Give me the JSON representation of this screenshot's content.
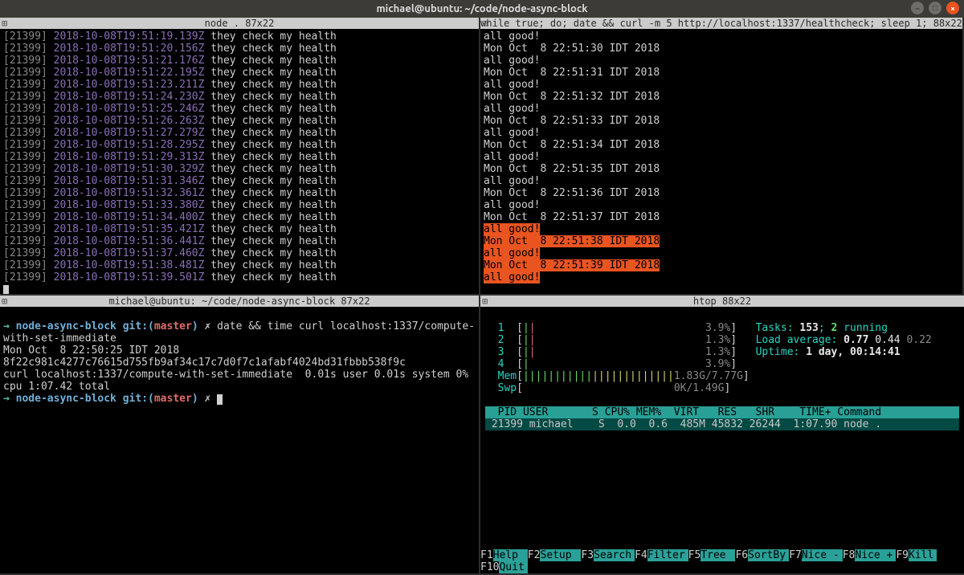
{
  "window": {
    "title": "michael@ubuntu: ~/code/node-async-block"
  },
  "panes": {
    "tl": {
      "title": "node . 87x22",
      "pid": "21399",
      "lines": [
        {
          "ts": "2018-10-08T19:51:19.139Z",
          "msg": "they check my health"
        },
        {
          "ts": "2018-10-08T19:51:20.156Z",
          "msg": "they check my health"
        },
        {
          "ts": "2018-10-08T19:51:21.176Z",
          "msg": "they check my health"
        },
        {
          "ts": "2018-10-08T19:51:22.195Z",
          "msg": "they check my health"
        },
        {
          "ts": "2018-10-08T19:51:23.211Z",
          "msg": "they check my health"
        },
        {
          "ts": "2018-10-08T19:51:24.230Z",
          "msg": "they check my health"
        },
        {
          "ts": "2018-10-08T19:51:25.246Z",
          "msg": "they check my health"
        },
        {
          "ts": "2018-10-08T19:51:26.263Z",
          "msg": "they check my health"
        },
        {
          "ts": "2018-10-08T19:51:27.279Z",
          "msg": "they check my health"
        },
        {
          "ts": "2018-10-08T19:51:28.295Z",
          "msg": "they check my health"
        },
        {
          "ts": "2018-10-08T19:51:29.313Z",
          "msg": "they check my health"
        },
        {
          "ts": "2018-10-08T19:51:30.329Z",
          "msg": "they check my health"
        },
        {
          "ts": "2018-10-08T19:51:31.346Z",
          "msg": "they check my health"
        },
        {
          "ts": "2018-10-08T19:51:32.361Z",
          "msg": "they check my health"
        },
        {
          "ts": "2018-10-08T19:51:33.380Z",
          "msg": "they check my health"
        },
        {
          "ts": "2018-10-08T19:51:34.400Z",
          "msg": "they check my health"
        },
        {
          "ts": "2018-10-08T19:51:35.421Z",
          "msg": "they check my health"
        },
        {
          "ts": "2018-10-08T19:51:36.441Z",
          "msg": "they check my health"
        },
        {
          "ts": "2018-10-08T19:51:37.460Z",
          "msg": "they check my health"
        },
        {
          "ts": "2018-10-08T19:51:38.481Z",
          "msg": "they check my health"
        },
        {
          "ts": "2018-10-08T19:51:39.501Z",
          "msg": "they check my health"
        }
      ]
    },
    "tr": {
      "title": "while true; do; date && curl -m 5 http://localhost:1337/healthcheck; sleep 1;  88x22",
      "lines": [
        "all good!",
        "Mon Oct  8 22:51:30 IDT 2018",
        "all good!",
        "Mon Oct  8 22:51:31 IDT 2018",
        "all good!",
        "Mon Oct  8 22:51:32 IDT 2018",
        "all good!",
        "Mon Oct  8 22:51:33 IDT 2018",
        "all good!",
        "Mon Oct  8 22:51:34 IDT 2018",
        "all good!",
        "Mon Oct  8 22:51:35 IDT 2018",
        "all good!",
        "Mon Oct  8 22:51:36 IDT 2018",
        "all good!",
        "Mon Oct  8 22:51:37 IDT 2018"
      ],
      "hlines": [
        "all good!",
        "Mon Oct  8 22:51:38 IDT 2018",
        "all good!",
        "Mon Oct  8 22:51:39 IDT 2018",
        "all good!"
      ]
    },
    "bl": {
      "title": "michael@ubuntu: ~/code/node-async-block 87x22",
      "prompt_dir": "node-async-block",
      "branch": "master",
      "cmd": "date && time curl localhost:1337/compute-with-set-immediate",
      "out": [
        "Mon Oct  8 22:50:25 IDT 2018",
        "8f22c981c4277c76615d755fb9af34c17c7d0f7c1afabf4024bd31fbbb538f9c",
        "curl localhost:1337/compute-with-set-immediate  0.01s user 0.01s system 0% cpu 1:07.42 total"
      ]
    },
    "br": {
      "title": "htop 88x22",
      "cpus": [
        {
          "id": "1",
          "pct": "3.9%"
        },
        {
          "id": "2",
          "pct": "1.3%"
        },
        {
          "id": "3",
          "pct": "1.3%"
        },
        {
          "id": "4",
          "pct": "3.9%"
        }
      ],
      "mem": "1.83G/7.77G",
      "swp": "0K/1.49G",
      "tasks": {
        "total": "153",
        "running": "2"
      },
      "load": [
        "0.77",
        "0.44",
        "0.22"
      ],
      "uptime": "1 day, 00:14:41",
      "header": "  PID USER       S CPU% MEM%  VIRT   RES   SHR    TIME+ Command",
      "proc": {
        "pid": "21399",
        "user": "michael",
        "s": "S",
        "cpu": "0.0",
        "mem": "0.6",
        "virt": "485M",
        "res": "45832",
        "shr": "26244",
        "time": "1:07.90",
        "cmd": "node ."
      },
      "fkeys": [
        {
          "k": "F1",
          "l": "Help "
        },
        {
          "k": "F2",
          "l": "Setup "
        },
        {
          "k": "F3",
          "l": "Search"
        },
        {
          "k": "F4",
          "l": "Filter"
        },
        {
          "k": "F5",
          "l": "Tree "
        },
        {
          "k": "F6",
          "l": "SortBy"
        },
        {
          "k": "F7",
          "l": "Nice -"
        },
        {
          "k": "F8",
          "l": "Nice +"
        },
        {
          "k": "F9",
          "l": "Kill "
        },
        {
          "k": "F10",
          "l": "Quit "
        }
      ]
    }
  }
}
